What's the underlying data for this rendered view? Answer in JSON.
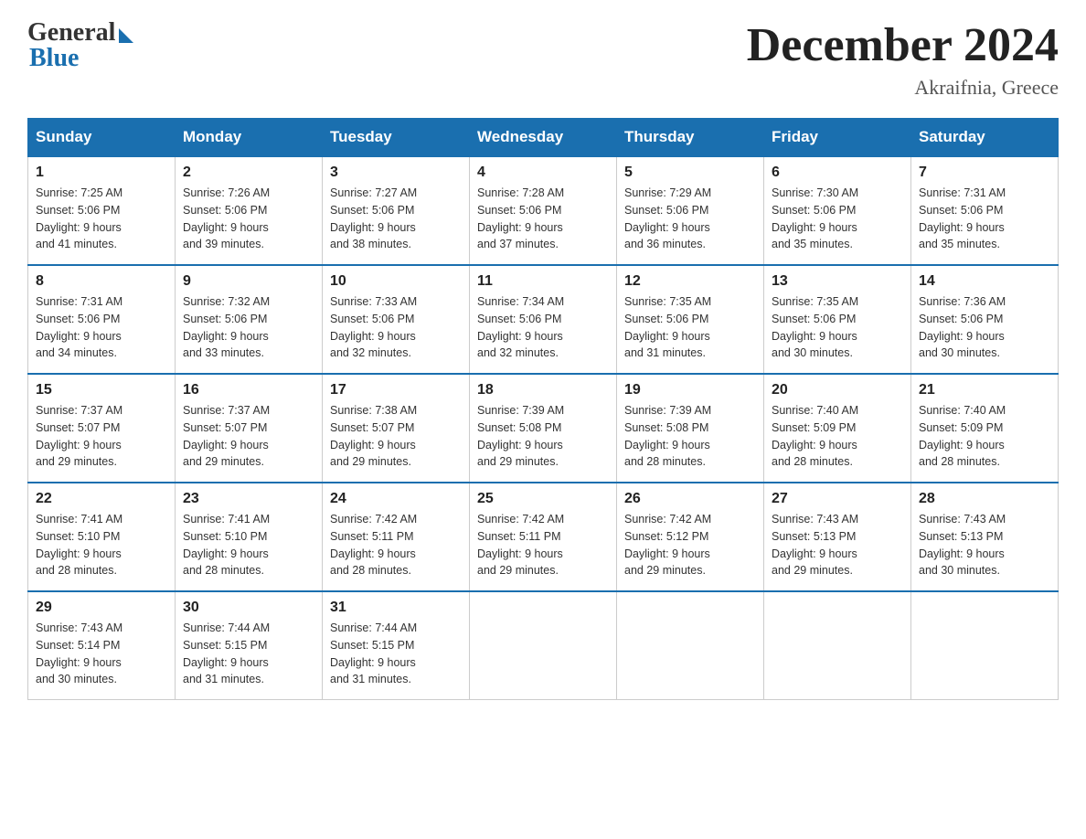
{
  "header": {
    "logo_general": "General",
    "logo_blue": "Blue",
    "month_title": "December 2024",
    "location": "Akraifnia, Greece"
  },
  "calendar": {
    "days_of_week": [
      "Sunday",
      "Monday",
      "Tuesday",
      "Wednesday",
      "Thursday",
      "Friday",
      "Saturday"
    ],
    "weeks": [
      [
        {
          "day": "1",
          "sunrise": "7:25 AM",
          "sunset": "5:06 PM",
          "daylight": "9 hours and 41 minutes."
        },
        {
          "day": "2",
          "sunrise": "7:26 AM",
          "sunset": "5:06 PM",
          "daylight": "9 hours and 39 minutes."
        },
        {
          "day": "3",
          "sunrise": "7:27 AM",
          "sunset": "5:06 PM",
          "daylight": "9 hours and 38 minutes."
        },
        {
          "day": "4",
          "sunrise": "7:28 AM",
          "sunset": "5:06 PM",
          "daylight": "9 hours and 37 minutes."
        },
        {
          "day": "5",
          "sunrise": "7:29 AM",
          "sunset": "5:06 PM",
          "daylight": "9 hours and 36 minutes."
        },
        {
          "day": "6",
          "sunrise": "7:30 AM",
          "sunset": "5:06 PM",
          "daylight": "9 hours and 35 minutes."
        },
        {
          "day": "7",
          "sunrise": "7:31 AM",
          "sunset": "5:06 PM",
          "daylight": "9 hours and 35 minutes."
        }
      ],
      [
        {
          "day": "8",
          "sunrise": "7:31 AM",
          "sunset": "5:06 PM",
          "daylight": "9 hours and 34 minutes."
        },
        {
          "day": "9",
          "sunrise": "7:32 AM",
          "sunset": "5:06 PM",
          "daylight": "9 hours and 33 minutes."
        },
        {
          "day": "10",
          "sunrise": "7:33 AM",
          "sunset": "5:06 PM",
          "daylight": "9 hours and 32 minutes."
        },
        {
          "day": "11",
          "sunrise": "7:34 AM",
          "sunset": "5:06 PM",
          "daylight": "9 hours and 32 minutes."
        },
        {
          "day": "12",
          "sunrise": "7:35 AM",
          "sunset": "5:06 PM",
          "daylight": "9 hours and 31 minutes."
        },
        {
          "day": "13",
          "sunrise": "7:35 AM",
          "sunset": "5:06 PM",
          "daylight": "9 hours and 30 minutes."
        },
        {
          "day": "14",
          "sunrise": "7:36 AM",
          "sunset": "5:06 PM",
          "daylight": "9 hours and 30 minutes."
        }
      ],
      [
        {
          "day": "15",
          "sunrise": "7:37 AM",
          "sunset": "5:07 PM",
          "daylight": "9 hours and 29 minutes."
        },
        {
          "day": "16",
          "sunrise": "7:37 AM",
          "sunset": "5:07 PM",
          "daylight": "9 hours and 29 minutes."
        },
        {
          "day": "17",
          "sunrise": "7:38 AM",
          "sunset": "5:07 PM",
          "daylight": "9 hours and 29 minutes."
        },
        {
          "day": "18",
          "sunrise": "7:39 AM",
          "sunset": "5:08 PM",
          "daylight": "9 hours and 29 minutes."
        },
        {
          "day": "19",
          "sunrise": "7:39 AM",
          "sunset": "5:08 PM",
          "daylight": "9 hours and 28 minutes."
        },
        {
          "day": "20",
          "sunrise": "7:40 AM",
          "sunset": "5:09 PM",
          "daylight": "9 hours and 28 minutes."
        },
        {
          "day": "21",
          "sunrise": "7:40 AM",
          "sunset": "5:09 PM",
          "daylight": "9 hours and 28 minutes."
        }
      ],
      [
        {
          "day": "22",
          "sunrise": "7:41 AM",
          "sunset": "5:10 PM",
          "daylight": "9 hours and 28 minutes."
        },
        {
          "day": "23",
          "sunrise": "7:41 AM",
          "sunset": "5:10 PM",
          "daylight": "9 hours and 28 minutes."
        },
        {
          "day": "24",
          "sunrise": "7:42 AM",
          "sunset": "5:11 PM",
          "daylight": "9 hours and 28 minutes."
        },
        {
          "day": "25",
          "sunrise": "7:42 AM",
          "sunset": "5:11 PM",
          "daylight": "9 hours and 29 minutes."
        },
        {
          "day": "26",
          "sunrise": "7:42 AM",
          "sunset": "5:12 PM",
          "daylight": "9 hours and 29 minutes."
        },
        {
          "day": "27",
          "sunrise": "7:43 AM",
          "sunset": "5:13 PM",
          "daylight": "9 hours and 29 minutes."
        },
        {
          "day": "28",
          "sunrise": "7:43 AM",
          "sunset": "5:13 PM",
          "daylight": "9 hours and 30 minutes."
        }
      ],
      [
        {
          "day": "29",
          "sunrise": "7:43 AM",
          "sunset": "5:14 PM",
          "daylight": "9 hours and 30 minutes."
        },
        {
          "day": "30",
          "sunrise": "7:44 AM",
          "sunset": "5:15 PM",
          "daylight": "9 hours and 31 minutes."
        },
        {
          "day": "31",
          "sunrise": "7:44 AM",
          "sunset": "5:15 PM",
          "daylight": "9 hours and 31 minutes."
        },
        null,
        null,
        null,
        null
      ]
    ],
    "labels": {
      "sunrise": "Sunrise:",
      "sunset": "Sunset:",
      "daylight": "Daylight:"
    }
  }
}
